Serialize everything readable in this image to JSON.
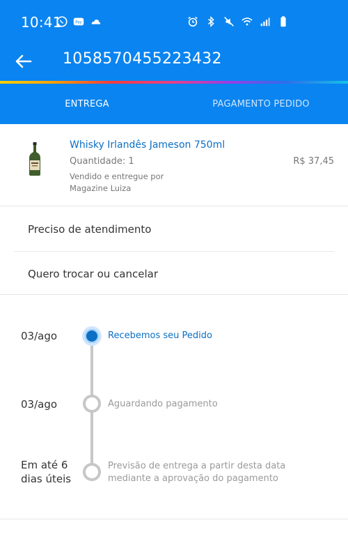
{
  "status_bar": {
    "time": "10:41",
    "left_icons": [
      "whatsapp-icon",
      "samsung-pay-icon",
      "cloud-icon"
    ],
    "right_icons": [
      "alarm-icon",
      "bluetooth-icon",
      "mute-icon",
      "wifi-icon",
      "signal-icon",
      "battery-icon"
    ]
  },
  "app_bar": {
    "title": "1058570455223432",
    "back_icon": "back-arrow-icon"
  },
  "tabs": [
    {
      "label": "ENTREGA",
      "selected": true
    },
    {
      "label": "PAGAMENTO PEDIDO",
      "selected": false
    }
  ],
  "product": {
    "name": "Whisky Irlandês Jameson 750ml",
    "quantity": "Quantidade: 1",
    "seller": "Vendido e entregue por Magazine Luiza",
    "price": "R$ 37,45"
  },
  "help": {
    "item1": "Preciso de atendimento",
    "item2": "Quero trocar ou cancelar"
  },
  "timeline": [
    {
      "date": "03/ago",
      "text": "Recebemos seu Pedido",
      "status": "done"
    },
    {
      "date": "03/ago",
      "text": "Aguardando pagamento",
      "status": "pending"
    },
    {
      "date": "Em até 6 dias úteis",
      "text": "Previsão de entrega a partir desta data mediante a aprovação do pagamento",
      "status": "pending"
    }
  ],
  "colors": {
    "primary": "#0a84f0",
    "link": "#0b6fc4",
    "inactive": "#c7c7c7"
  }
}
